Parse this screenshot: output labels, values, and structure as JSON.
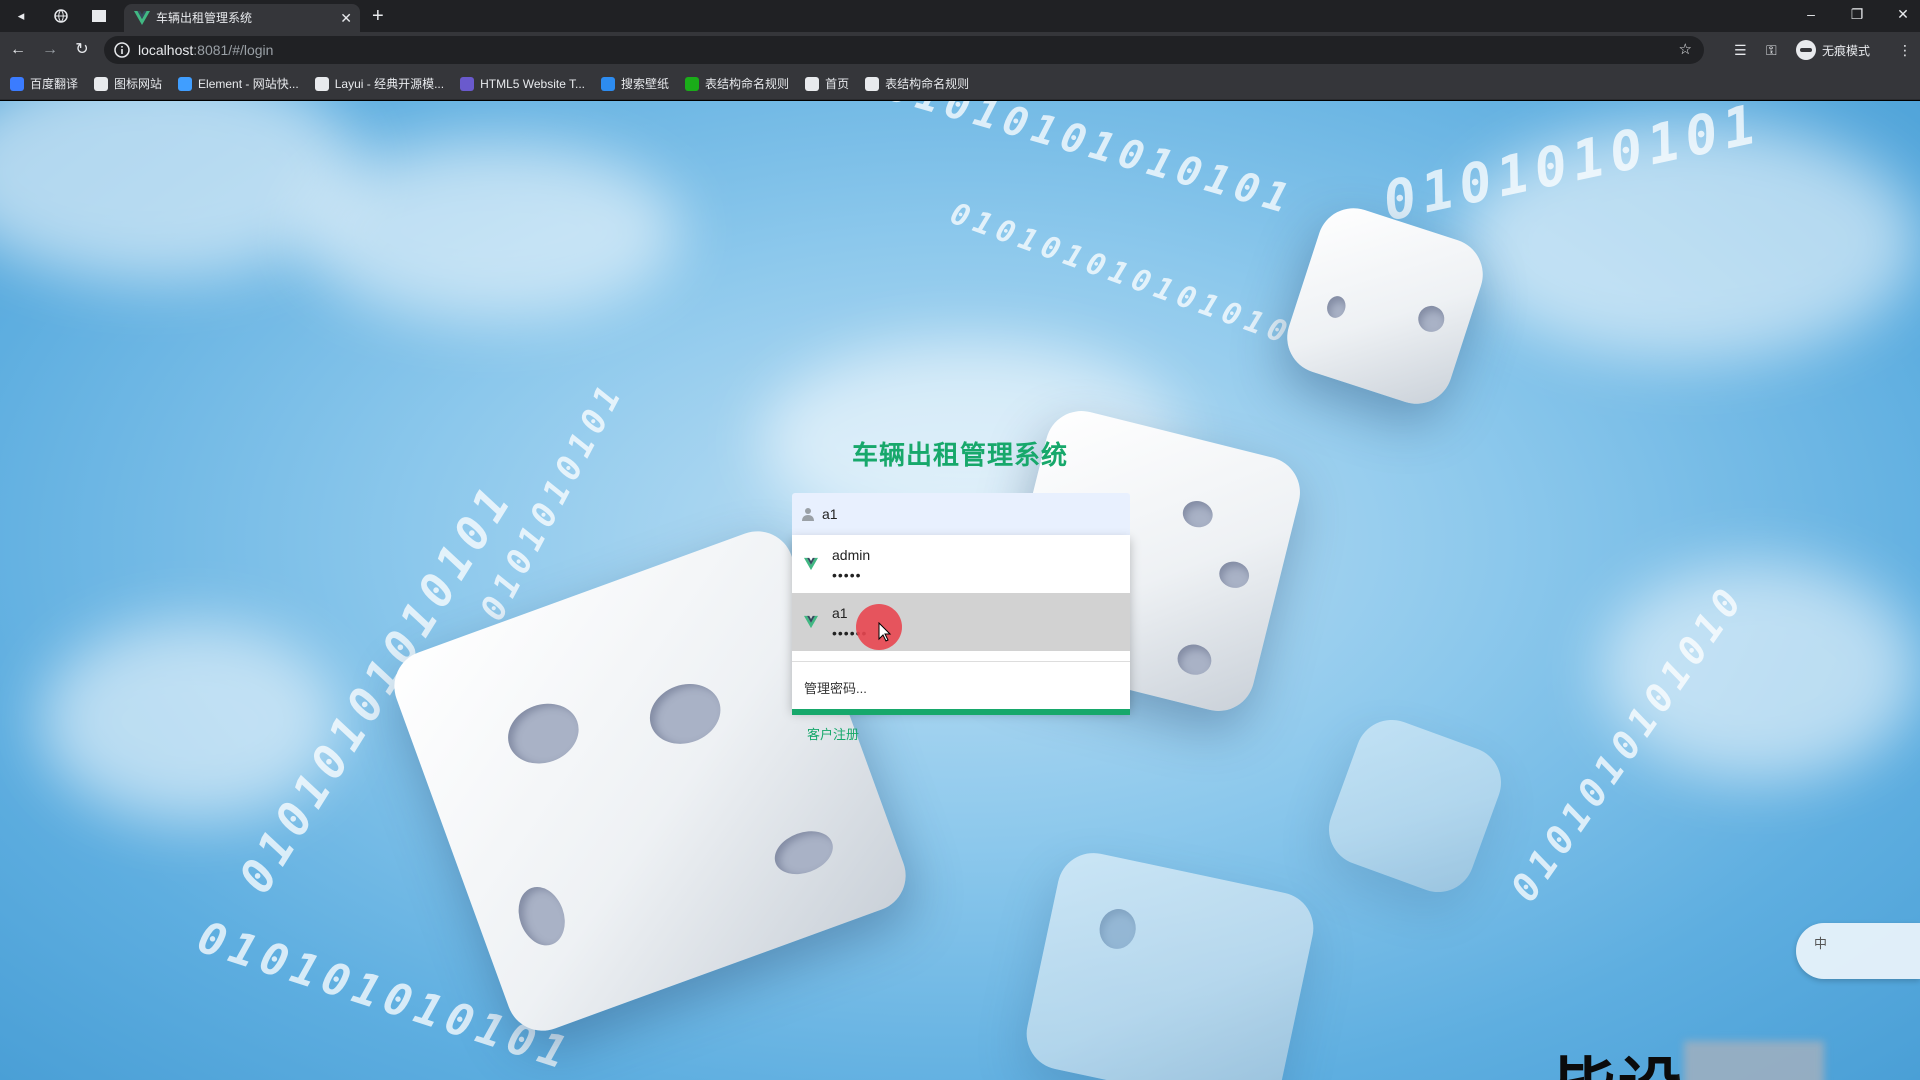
{
  "browser": {
    "tab_title": "车辆出租管理系统",
    "tab_close": "✕",
    "new_tab": "+",
    "url_host": "localhost",
    "url_rest": ":8081/#/login",
    "incognito_label": "无痕模式",
    "window_controls": [
      "–",
      "❐",
      "✕"
    ],
    "bookmarks": [
      {
        "label": "百度翻译",
        "color": "#3b7cff"
      },
      {
        "label": "图标网站",
        "color": "#e8eaed"
      },
      {
        "label": "Element - 网站快...",
        "color": "#409eff"
      },
      {
        "label": "Layui - 经典开源模...",
        "color": "#e8eaed"
      },
      {
        "label": "HTML5 Website T...",
        "color": "#6a5acd"
      },
      {
        "label": "搜索壁纸",
        "color": "#2d8cf0"
      },
      {
        "label": "表结构命名规则",
        "color": "#1aad19"
      },
      {
        "label": "首页",
        "color": "#e8eaed"
      },
      {
        "label": "表结构命名规则",
        "color": "#e8eaed"
      }
    ]
  },
  "login": {
    "title": "车辆出租管理系统",
    "username_value": "a1",
    "register_link": "客户注册",
    "accent_color": "#17a86b"
  },
  "autofill": {
    "items": [
      {
        "username": "admin",
        "password_mask": "•••••"
      },
      {
        "username": "a1",
        "password_mask": "••••••"
      }
    ],
    "manage_label": "管理密码..."
  },
  "ime": {
    "mode": "中"
  },
  "watermark": {
    "text": "毕设"
  },
  "background": {
    "binary_strings": [
      "01010101010101",
      "0101010101010101",
      "0101010101",
      "01010101010101",
      "0101010101",
      "010101010101",
      "0101010101010"
    ]
  }
}
